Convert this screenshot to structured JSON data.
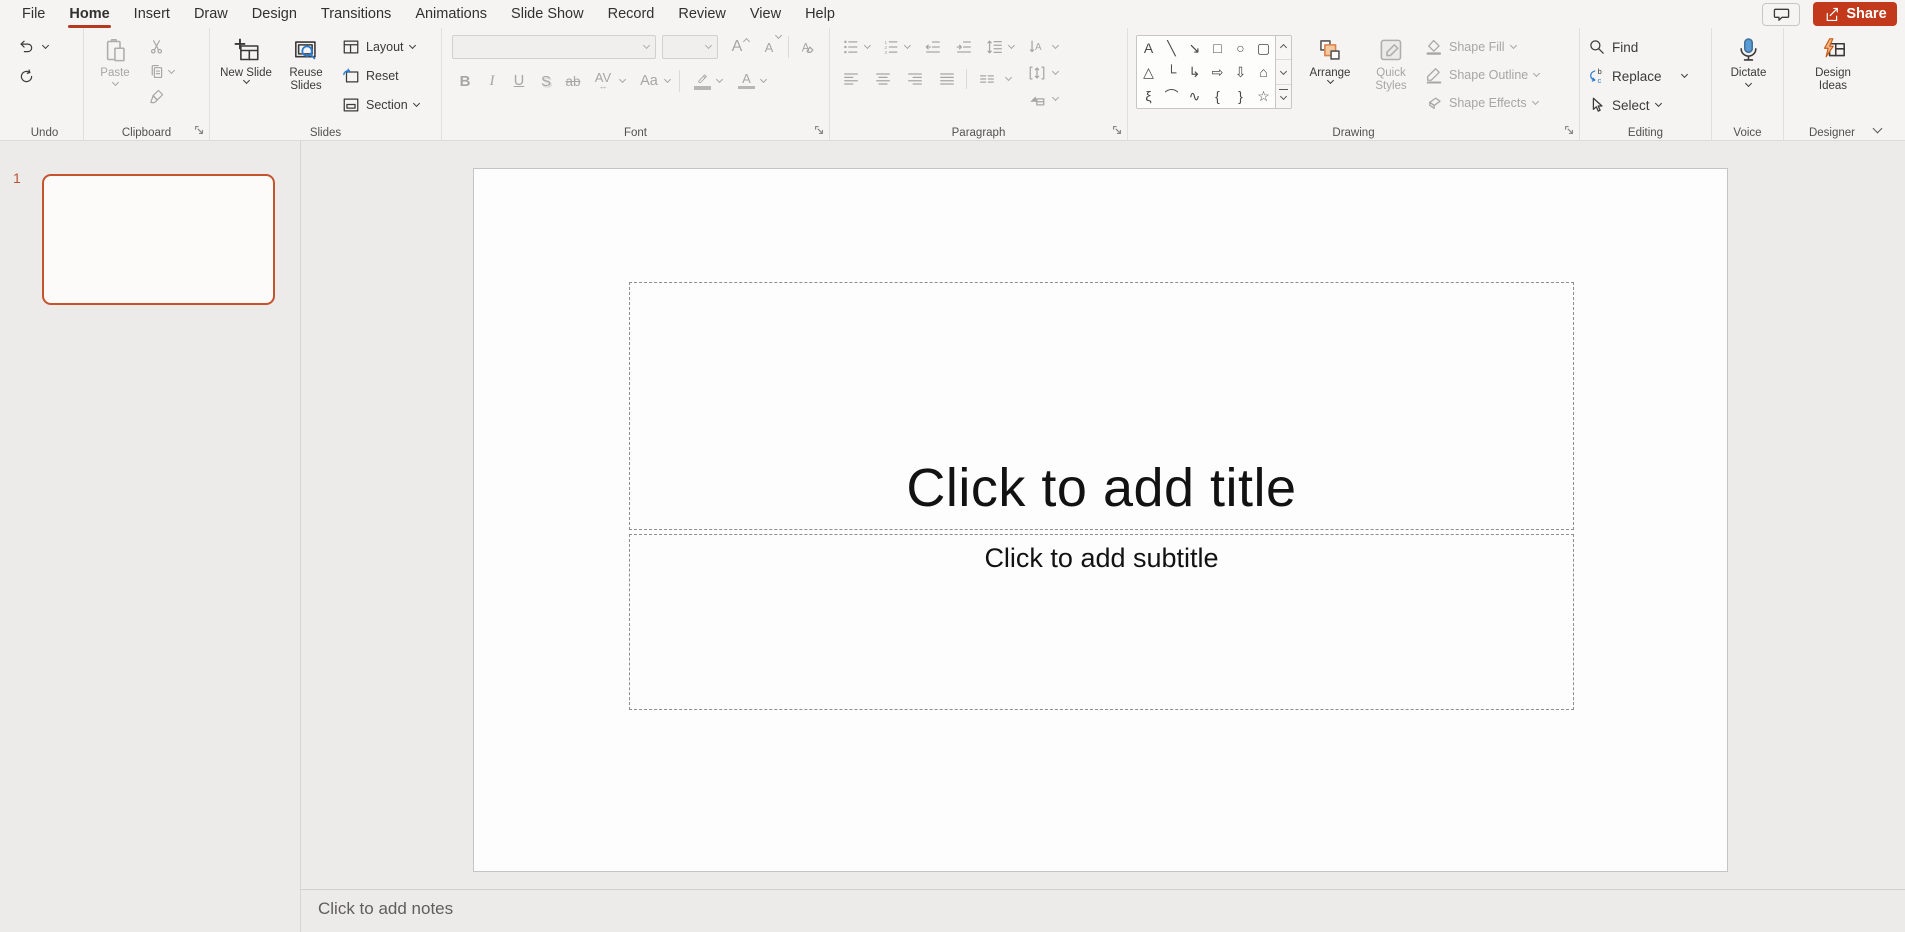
{
  "menubar": {
    "tabs": [
      {
        "name": "menu-tab-file",
        "label": "File"
      },
      {
        "name": "menu-tab-home",
        "label": "Home",
        "active": true
      },
      {
        "name": "menu-tab-insert",
        "label": "Insert"
      },
      {
        "name": "menu-tab-draw",
        "label": "Draw"
      },
      {
        "name": "menu-tab-design",
        "label": "Design"
      },
      {
        "name": "menu-tab-transitions",
        "label": "Transitions"
      },
      {
        "name": "menu-tab-animations",
        "label": "Animations"
      },
      {
        "name": "menu-tab-slideshow",
        "label": "Slide Show"
      },
      {
        "name": "menu-tab-record",
        "label": "Record"
      },
      {
        "name": "menu-tab-review",
        "label": "Review"
      },
      {
        "name": "menu-tab-view",
        "label": "View"
      },
      {
        "name": "menu-tab-help",
        "label": "Help"
      }
    ],
    "share_label": "Share"
  },
  "ribbon": {
    "undo": {
      "label": "Undo"
    },
    "clipboard": {
      "label": "Clipboard",
      "paste_label": "Paste"
    },
    "slides": {
      "label": "Slides",
      "new_slide": "New Slide",
      "reuse_slides": "Reuse Slides",
      "layout": "Layout",
      "reset": "Reset",
      "section": "Section"
    },
    "font": {
      "label": "Font",
      "bold": "B",
      "italic": "I",
      "underline": "U",
      "shadow": "S",
      "strike_icon": "ab",
      "char_spacing": "AV",
      "change_case": "Aa",
      "grow_font": "A",
      "shrink_font": "A",
      "clear_format": "A",
      "font_color": "A"
    },
    "paragraph": {
      "label": "Paragraph"
    },
    "drawing": {
      "label": "Drawing",
      "arrange": "Arrange",
      "quick_styles": "Quick Styles",
      "shape_fill": "Shape Fill",
      "shape_outline": "Shape Outline",
      "shape_effects": "Shape Effects",
      "gallery": [
        {
          "name": "shape-text-box-icon",
          "glyph": "A"
        },
        {
          "name": "shape-line-icon",
          "glyph": "╲"
        },
        {
          "name": "shape-line-arrow-icon",
          "glyph": "↘"
        },
        {
          "name": "shape-rectangle-icon",
          "glyph": "□"
        },
        {
          "name": "shape-oval-icon",
          "glyph": "○"
        },
        {
          "name": "shape-rounded-rectangle-icon",
          "glyph": "▢"
        },
        {
          "name": "shape-triangle-icon",
          "glyph": "△"
        },
        {
          "name": "shape-elbow-connector-icon",
          "glyph": "└"
        },
        {
          "name": "shape-elbow-arrow-icon",
          "glyph": "↳"
        },
        {
          "name": "shape-arrow-right-icon",
          "glyph": "⇨"
        },
        {
          "name": "shape-arrow-down-icon",
          "glyph": "⇩"
        },
        {
          "name": "shape-freeform-icon",
          "glyph": "⌂"
        },
        {
          "name": "shape-scribble-icon",
          "glyph": "ξ"
        },
        {
          "name": "shape-arc-icon",
          "glyph": "⌒"
        },
        {
          "name": "shape-curve-icon",
          "glyph": "∿"
        },
        {
          "name": "shape-left-brace-icon",
          "glyph": "{"
        },
        {
          "name": "shape-right-brace-icon",
          "glyph": "}"
        },
        {
          "name": "shape-star-icon",
          "glyph": "☆"
        }
      ]
    },
    "editing": {
      "label": "Editing",
      "find": "Find",
      "replace": "Replace",
      "select": "Select"
    },
    "voice": {
      "label": "Voice",
      "dictate": "Dictate"
    },
    "designer": {
      "label": "Designer",
      "design_ideas": "Design Ideas"
    }
  },
  "slides_panel": {
    "slide_number": "1"
  },
  "canvas": {
    "title_placeholder": "Click to add title",
    "subtitle_placeholder": "Click to add subtitle"
  },
  "notes": {
    "placeholder": "Click to add notes"
  },
  "colors": {
    "accent_red": "#b5391f",
    "share_button": "#c23a1b",
    "thumbnail_border": "#c4532e",
    "mic_blue": "#5b9bd5",
    "arrange_fill": "#f5c9a0",
    "bolt_fill": "#f4b183"
  }
}
